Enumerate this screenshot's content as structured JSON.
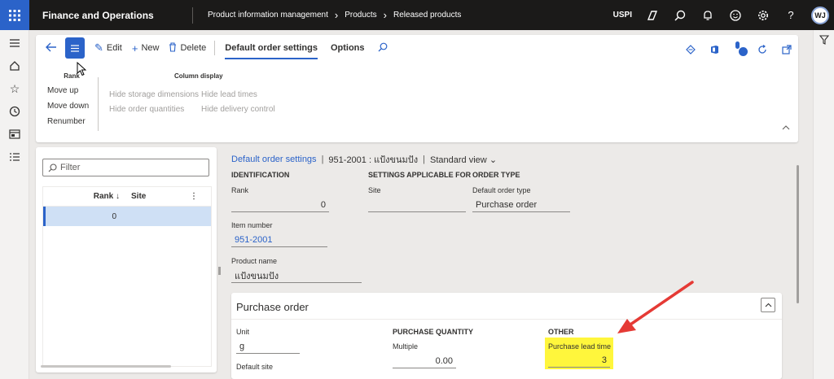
{
  "topbar": {
    "app_title": "Finance and Operations",
    "breadcrumb": [
      "Product information management",
      "Products",
      "Released products"
    ],
    "company": "USPI",
    "avatar_initials": "WJ",
    "icons": [
      "copilot-icon",
      "search-icon",
      "bell-icon",
      "smiley-icon",
      "gear-icon",
      "help-icon"
    ]
  },
  "leftnav": {
    "icons": [
      "hamburger-icon",
      "home-icon",
      "star-icon",
      "clock-icon",
      "workspace-icon",
      "list-icon"
    ]
  },
  "actionpane": {
    "edit_label": "Edit",
    "new_label": "New",
    "delete_label": "Delete",
    "tabs": [
      "Default order settings",
      "Options"
    ],
    "active_tab": "Default order settings"
  },
  "ribbon": {
    "rank_group": {
      "title": "Rank",
      "items": [
        "Move up",
        "Move down",
        "Renumber"
      ]
    },
    "column_group": {
      "title": "Column display",
      "items": [
        "Hide storage dimensions",
        "Hide lead times",
        "Hide order quantities",
        "Hide delivery control"
      ]
    }
  },
  "list": {
    "filter_placeholder": "Filter",
    "columns": [
      "Rank",
      "Site"
    ],
    "rows": [
      {
        "rank": "0",
        "site": ""
      }
    ]
  },
  "detail": {
    "crumb_link": "Default order settings",
    "crumb_item": "951-2001 : แป้งขนมปัง",
    "crumb_view": "Standard view",
    "sections": {
      "identification": "IDENTIFICATION",
      "settings_applicable": "SETTINGS APPLICABLE FOR",
      "order_type": "ORDER TYPE"
    },
    "rank_label": "Rank",
    "rank_value": "0",
    "site_label": "Site",
    "site_value": "",
    "default_order_type_label": "Default order type",
    "default_order_type_value": "Purchase order",
    "item_number_label": "Item number",
    "item_number_value": "951-2001",
    "product_name_label": "Product name",
    "product_name_value": "แป้งขนมปัง"
  },
  "purchase_order": {
    "title": "Purchase order",
    "unit_label": "Unit",
    "unit_value": "g",
    "default_site_label": "Default site",
    "purchase_quantity_header": "PURCHASE QUANTITY",
    "multiple_label": "Multiple",
    "multiple_value": "0.00",
    "other_header": "OTHER",
    "lead_time_label": "Purchase lead time",
    "lead_time_value": "3"
  },
  "colors": {
    "accent": "#2b63c9",
    "topbar": "#1b1a19",
    "highlight": "#fff63c",
    "annotation_arrow": "#e53a35"
  }
}
